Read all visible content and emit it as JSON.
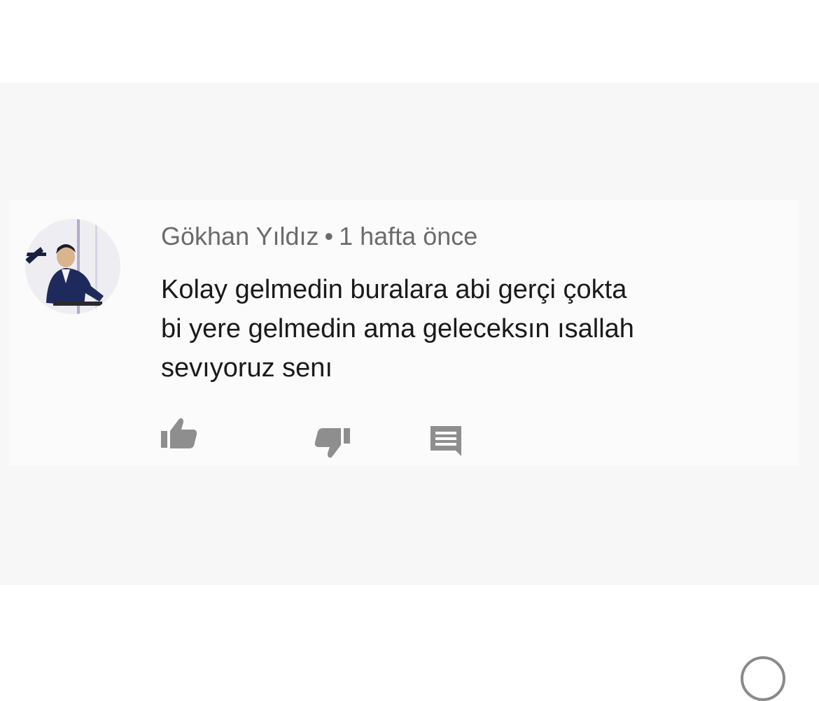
{
  "comment": {
    "author": "Gökhan Yıldız",
    "separator": "•",
    "timestamp": "1 hafta önce",
    "text_lines": [
      "Kolay gelmedin buralara abi gerçi çokta",
      "bi yere gelmedin ama geleceksın ısallah",
      "sevıyoruz senı"
    ]
  },
  "actions": {
    "like_icon": "thumbs-up-icon",
    "dislike_icon": "thumbs-down-icon",
    "reply_icon": "comment-icon"
  },
  "colors": {
    "meta_text": "#6b6b6b",
    "body_text": "#1a1a1a",
    "icon": "#8e8e8e",
    "avatar_figure": "#1f2a5c"
  }
}
